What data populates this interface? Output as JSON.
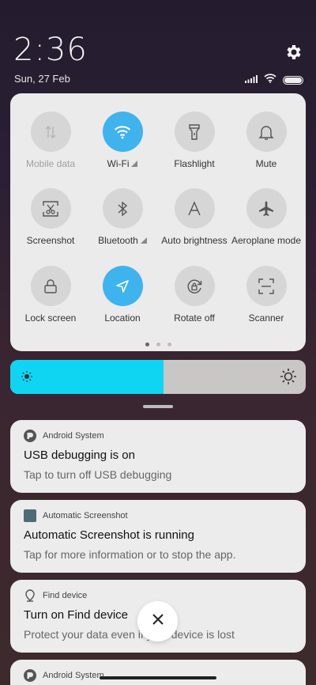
{
  "status": {
    "time": "2:36",
    "date": "Sun, 27 Feb"
  },
  "quick_settings": {
    "tiles": [
      {
        "label": "Mobile data",
        "icon": "mobile-data-icon",
        "on": false,
        "dim": true
      },
      {
        "label": "Wi-Fi",
        "icon": "wifi-icon",
        "on": true,
        "dim": false
      },
      {
        "label": "Flashlight",
        "icon": "flashlight-icon",
        "on": false,
        "dim": false
      },
      {
        "label": "Mute",
        "icon": "bell-icon",
        "on": false,
        "dim": false
      },
      {
        "label": "Screenshot",
        "icon": "screenshot-icon",
        "on": false,
        "dim": false
      },
      {
        "label": "Bluetooth",
        "icon": "bluetooth-icon",
        "on": false,
        "dim": false
      },
      {
        "label": "Auto brightness",
        "icon": "auto-brightness-icon",
        "on": false,
        "dim": false
      },
      {
        "label": "Aeroplane mode",
        "icon": "airplane-icon",
        "on": false,
        "dim": false
      },
      {
        "label": "Lock screen",
        "icon": "lock-icon",
        "on": false,
        "dim": false
      },
      {
        "label": "Location",
        "icon": "location-icon",
        "on": true,
        "dim": false
      },
      {
        "label": "Rotate off",
        "icon": "rotate-lock-icon",
        "on": false,
        "dim": false
      },
      {
        "label": "Scanner",
        "icon": "scanner-icon",
        "on": false,
        "dim": false
      }
    ],
    "page_count": 3,
    "active_page": 1,
    "accent_color": "#3fb3ee"
  },
  "brightness": {
    "level": 0.52,
    "fill_color": "#0fd5f3"
  },
  "notifications": [
    {
      "app": "Android System",
      "title": "USB debugging is on",
      "body": "Tap to turn off USB debugging",
      "icon": "android-system-icon"
    },
    {
      "app": "Automatic Screenshot",
      "title": "Automatic Screenshot is running",
      "body": "Tap for more information or to stop the app.",
      "icon": "app-square-icon"
    },
    {
      "app": "Find device",
      "title": "Turn on Find device",
      "body": "Protect your data even if your device is lost",
      "icon": "location-pin-icon"
    },
    {
      "app": "Android System",
      "title": "",
      "body": "",
      "icon": "android-system-icon"
    }
  ]
}
